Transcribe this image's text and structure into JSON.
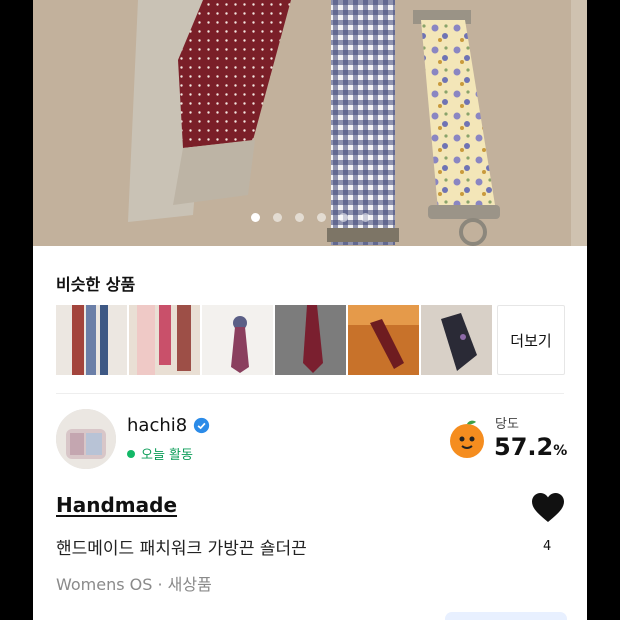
{
  "gallery": {
    "page_count": 6,
    "active_index": 0
  },
  "similar": {
    "title": "비슷한 상품",
    "more_label": "더보기",
    "items": [
      {
        "icon": "scarf-thumbnail"
      },
      {
        "icon": "floral-strap-thumbnail"
      },
      {
        "icon": "necktie-thumbnail"
      },
      {
        "icon": "red-necktie-thumbnail"
      },
      {
        "icon": "necktie-on-bag-thumbnail"
      },
      {
        "icon": "dark-necktie-thumbnail"
      }
    ]
  },
  "seller": {
    "name": "hachi8",
    "status": "오늘 활동",
    "sweetness_label": "당도",
    "sweetness_value": "57.2",
    "sweetness_unit": "%",
    "status_color": "#0b9d58"
  },
  "product": {
    "brand": "Handmade",
    "title": "핸드메이드 패치워크 가방끈 숄더끈",
    "meta": "Womens OS · 새상품",
    "like_count": "4"
  }
}
